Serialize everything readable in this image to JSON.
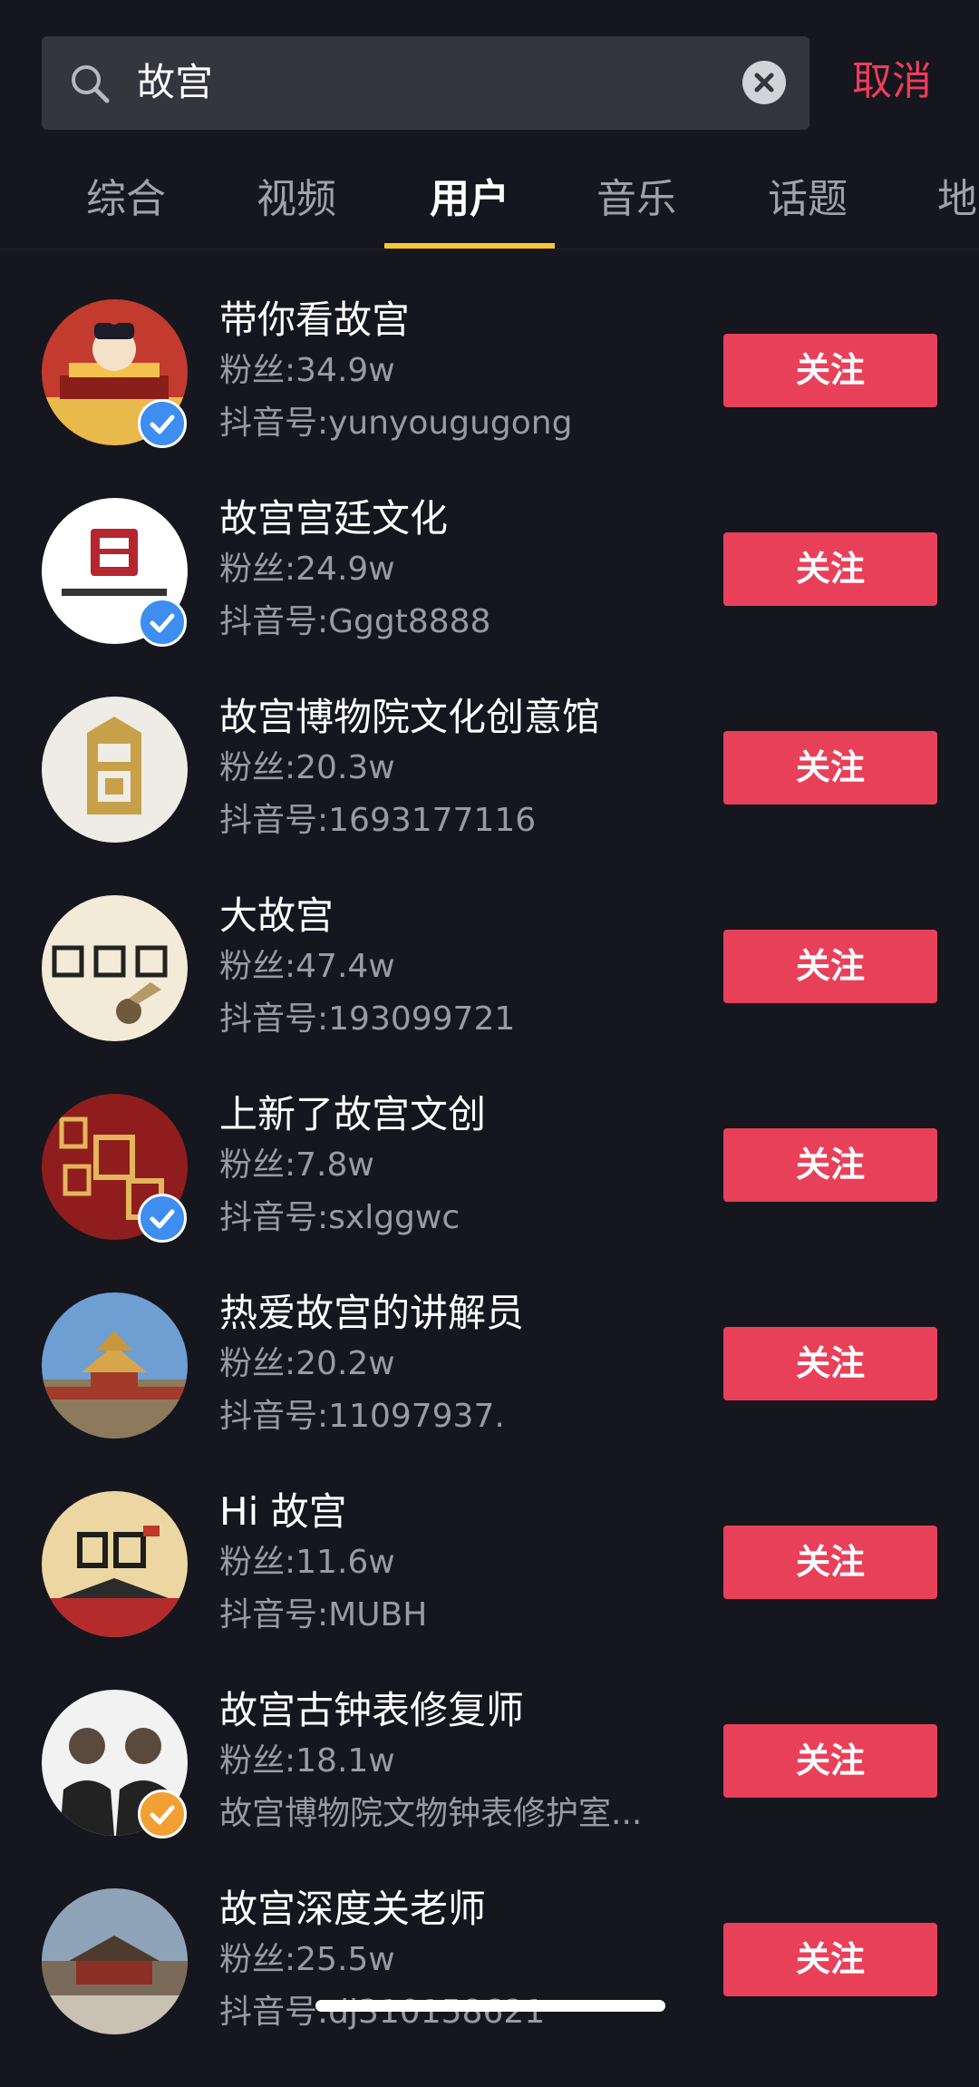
{
  "search": {
    "query": "故宫",
    "cancel_label": "取消"
  },
  "tabs": [
    {
      "label": "综合"
    },
    {
      "label": "视频"
    },
    {
      "label": "用户"
    },
    {
      "label": "音乐"
    },
    {
      "label": "话题"
    },
    {
      "label": "地"
    }
  ],
  "active_tab": "用户",
  "follow_label": "关注",
  "users": [
    {
      "name": "带你看故宫",
      "fans": "粉丝:34.9w",
      "douyin_id": "抖音号:yunyougugong",
      "verified": "blue"
    },
    {
      "name": "故宫宫廷文化",
      "fans": "粉丝:24.9w",
      "douyin_id": "抖音号:Gggt8888",
      "verified": "blue"
    },
    {
      "name": "故宫博物院文化创意馆",
      "fans": "粉丝:20.3w",
      "douyin_id": "抖音号:1693177116",
      "verified": "none"
    },
    {
      "name": "大故宫",
      "fans": "粉丝:47.4w",
      "douyin_id": "抖音号:193099721",
      "verified": "none"
    },
    {
      "name": "上新了故宫文创",
      "fans": "粉丝:7.8w",
      "douyin_id": "抖音号:sxlggwc",
      "verified": "blue"
    },
    {
      "name": "热爱故宫的讲解员",
      "fans": "粉丝:20.2w",
      "douyin_id": "抖音号:11097937.",
      "verified": "none"
    },
    {
      "name": "Hi 故宫",
      "fans": "粉丝:11.6w",
      "douyin_id": "抖音号:MUBH",
      "verified": "none"
    },
    {
      "name": "故宫古钟表修复师",
      "fans": "粉丝:18.1w",
      "douyin_id": "故宫博物院文物钟表修护室...",
      "verified": "orange"
    },
    {
      "name": "故宫深度关老师",
      "fans": "粉丝:25.5w",
      "douyin_id": "抖音号:dj310158621",
      "verified": "none"
    }
  ],
  "colors": {
    "background": "#15161e",
    "accent_red": "#e9405a",
    "tab_indicator": "#f8c72c",
    "verified_blue": "#3d8ef0",
    "verified_orange": "#f2a033"
  }
}
